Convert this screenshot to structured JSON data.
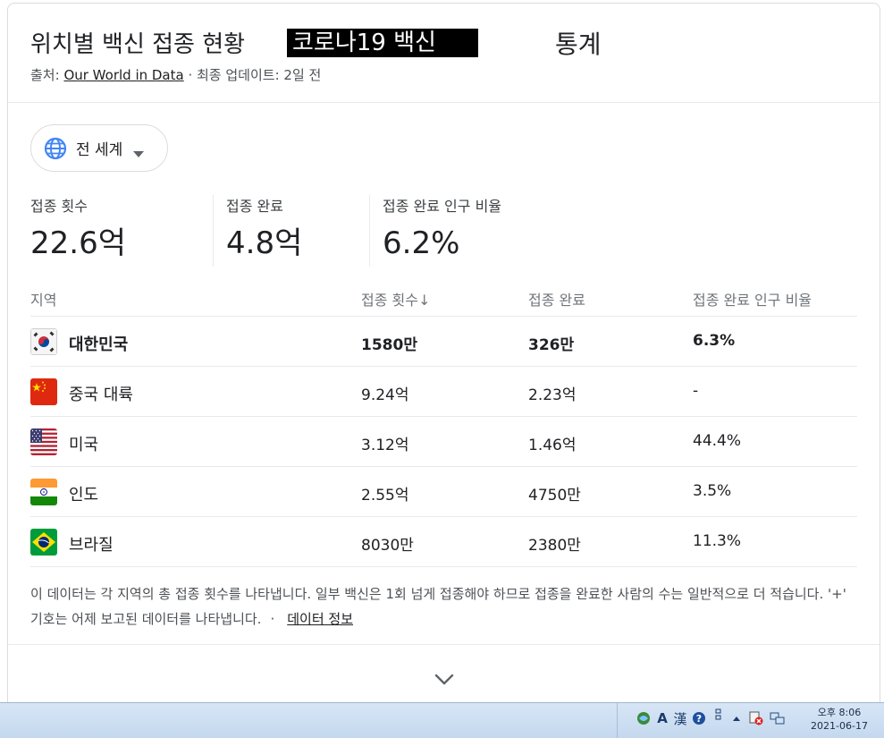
{
  "header": {
    "title": "위치별 백신 접종 현황",
    "highlight": "코로나19 백신",
    "title_suffix": "통계",
    "source_prefix": "출처: ",
    "source_link": "Our World in Data",
    "updated": " · 최종 업데이트: 2일 전"
  },
  "region_select": {
    "label": "전 세계",
    "icon": "globe-icon"
  },
  "stats": [
    {
      "label": "접종 횟수",
      "value": "22.6억"
    },
    {
      "label": "접종 완료",
      "value": "4.8억"
    },
    {
      "label": "접종 완료 인구 비율",
      "value": "6.2%"
    }
  ],
  "table": {
    "headers": {
      "region": "지역",
      "doses": "접종 횟수↓",
      "full": "접종 완료",
      "pct": "접종 완료 인구 비율"
    },
    "rows": [
      {
        "region": "대한민국",
        "doses": "1580만",
        "full": "326만",
        "pct": "6.3%",
        "flag": "kr"
      },
      {
        "region": "중국 대륙",
        "doses": "9.24억",
        "full": "2.23억",
        "pct": "-",
        "flag": "cn"
      },
      {
        "region": "미국",
        "doses": "3.12억",
        "full": "1.46억",
        "pct": "44.4%",
        "flag": "us"
      },
      {
        "region": "인도",
        "doses": "2.55억",
        "full": "4750만",
        "pct": "3.5%",
        "flag": "in"
      },
      {
        "region": "브라질",
        "doses": "8030만",
        "full": "2380만",
        "pct": "11.3%",
        "flag": "br"
      }
    ]
  },
  "footnote": {
    "text": "이 데이터는 각 지역의 총 접종 횟수를 나타냅니다. 일부 백신은 1회 넘게 접종해야 하므로 접종을 완료한 사람의 수는 일반적으로 더 적습니다. '+' 기호는 어제 보고된 데이터를 나타냅니다.",
    "separator": "·",
    "link": "데이터 정보"
  },
  "taskbar": {
    "tray_text_a": "A",
    "tray_text_han": "漢",
    "clock_time": "오후 8:06",
    "clock_date": "2021-06-17"
  },
  "colors": {
    "accent_blue": "#4285f4",
    "text": "#202124",
    "muted": "#70757a",
    "divider": "#e8eaed"
  }
}
